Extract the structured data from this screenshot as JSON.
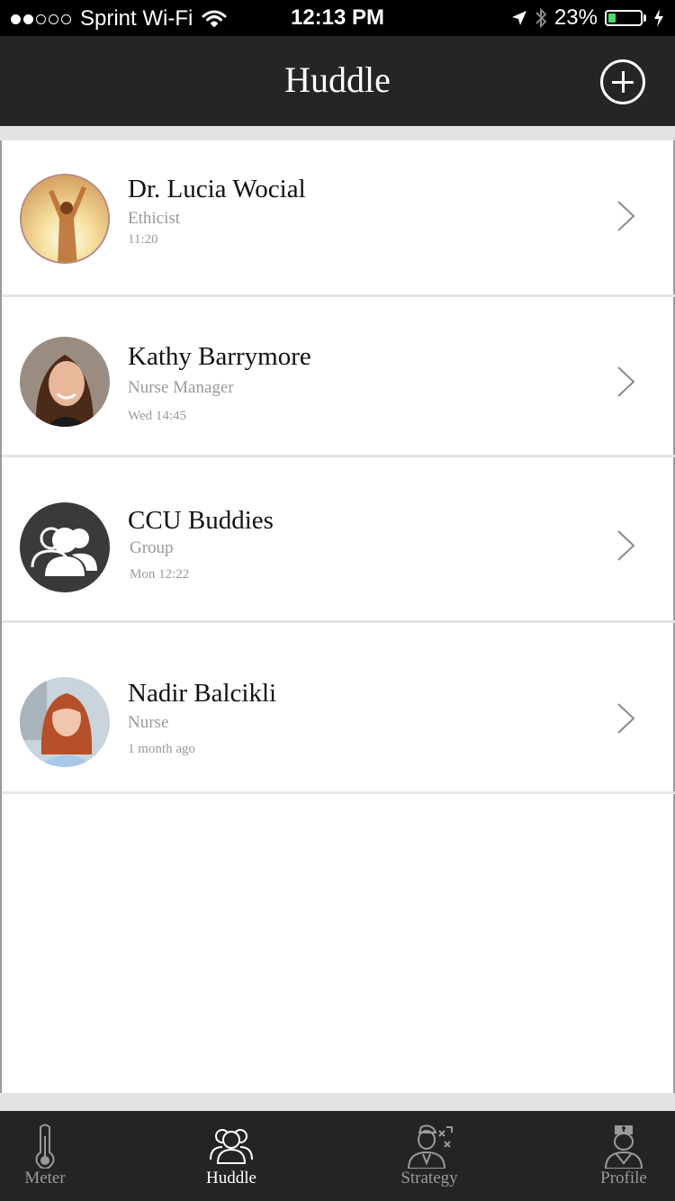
{
  "status_bar": {
    "carrier": "Sprint Wi-Fi",
    "time": "12:13 PM",
    "battery": "23%",
    "battery_level": 0.23,
    "icons": [
      "signal-dots-icon",
      "wifi-icon",
      "location-arrow-icon",
      "bluetooth-icon",
      "battery-icon",
      "charging-bolt-icon"
    ]
  },
  "header": {
    "title": "Huddle",
    "add_icon": "plus-circle-icon"
  },
  "conversations": [
    {
      "name": "Dr. Lucia Wocial",
      "role": "Ethicist",
      "time": "11:20",
      "avatar": "photo"
    },
    {
      "name": "Kathy Barrymore",
      "role": "Nurse Manager",
      "time": "Wed 14:45",
      "avatar": "photo"
    },
    {
      "name": "CCU Buddies",
      "role": "Group",
      "time": "Mon 12:22",
      "avatar": "group-icon"
    },
    {
      "name": "Nadir Balcikli",
      "role": "Nurse",
      "time": "1 month ago",
      "avatar": "photo"
    }
  ],
  "tabs": [
    {
      "label": "Meter",
      "icon": "thermometer-icon",
      "active": false
    },
    {
      "label": "Huddle",
      "icon": "group-icon",
      "active": true
    },
    {
      "label": "Strategy",
      "icon": "coach-strategy-icon",
      "active": false
    },
    {
      "label": "Profile",
      "icon": "nurse-icon",
      "active": false
    }
  ],
  "colors": {
    "nav_background": "#252525",
    "tab_background": "#242424",
    "tab_active": "#ffffff",
    "tab_inactive": "#9a9a9a",
    "secondary_text": "#999999",
    "battery_green": "#4cd964"
  }
}
